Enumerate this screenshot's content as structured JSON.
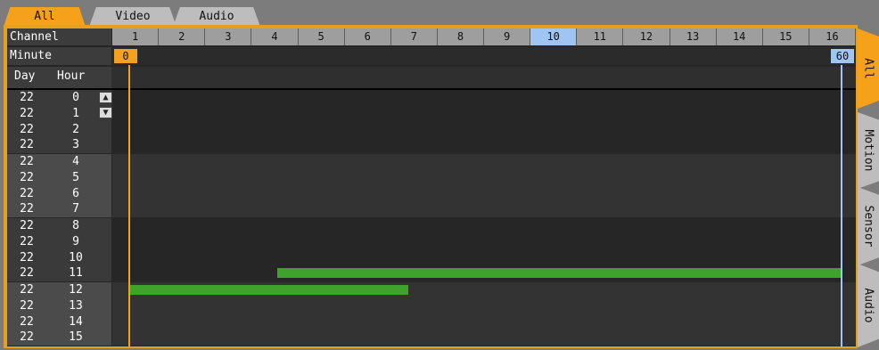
{
  "top_tabs": [
    {
      "label": "All",
      "active": true
    },
    {
      "label": "Video",
      "active": false
    },
    {
      "label": "Audio",
      "active": false
    }
  ],
  "side_tabs": [
    {
      "label": "All",
      "active": true
    },
    {
      "label": "Motion",
      "active": false
    },
    {
      "label": "Sensor",
      "active": false
    },
    {
      "label": "Audio",
      "active": false
    }
  ],
  "labels": {
    "channel": "Channel",
    "minute": "Minute",
    "day": "Day",
    "hour": "Hour"
  },
  "channels": [
    "1",
    "2",
    "3",
    "4",
    "5",
    "6",
    "7",
    "8",
    "9",
    "10",
    "11",
    "12",
    "13",
    "14",
    "15",
    "16"
  ],
  "selected_channel": "10",
  "minute_start": "0",
  "minute_end": "60",
  "rows": [
    {
      "day": "22",
      "hour": "0"
    },
    {
      "day": "22",
      "hour": "1"
    },
    {
      "day": "22",
      "hour": "2"
    },
    {
      "day": "22",
      "hour": "3"
    },
    {
      "day": "22",
      "hour": "4"
    },
    {
      "day": "22",
      "hour": "5"
    },
    {
      "day": "22",
      "hour": "6"
    },
    {
      "day": "22",
      "hour": "7"
    },
    {
      "day": "22",
      "hour": "8"
    },
    {
      "day": "22",
      "hour": "9"
    },
    {
      "day": "22",
      "hour": "10"
    },
    {
      "day": "22",
      "hour": "11"
    },
    {
      "day": "22",
      "hour": "12"
    },
    {
      "day": "22",
      "hour": "13"
    },
    {
      "day": "22",
      "hour": "14"
    },
    {
      "day": "22",
      "hour": "15"
    }
  ],
  "recordings": [
    {
      "hour": 11,
      "start_minute": 12.5,
      "end_minute": 60
    },
    {
      "hour": 12,
      "start_minute": 0,
      "end_minute": 23.5
    }
  ],
  "colors": {
    "accent": "#f5a11c",
    "recording": "#3fa22d",
    "selected_channel": "#9fc5f2",
    "end_marker": "#9fc5f2"
  }
}
